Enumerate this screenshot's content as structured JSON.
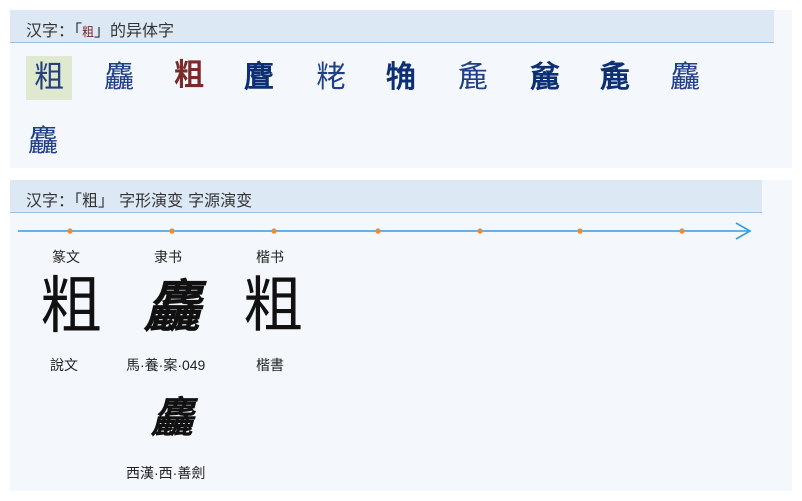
{
  "variants_panel": {
    "title_prefix": "汉字：「",
    "title_glyph": "粗",
    "title_suffix": "」的异体字",
    "items": [
      "粗",
      "麤",
      "粗",
      "麆",
      "粩",
      "觕",
      "麁",
      "麄",
      "麁",
      "麤",
      "麤"
    ]
  },
  "evolution_panel": {
    "title": "汉字：「粗」 字形演变 字源演变",
    "stages": [
      {
        "script": "篆文",
        "glyph": "粗",
        "source": "說文"
      },
      {
        "script": "隶书",
        "glyph": "麤",
        "source": "馬·養·案·049"
      },
      {
        "script": "楷书",
        "glyph": "粗",
        "source": "楷書"
      }
    ],
    "extra": {
      "glyph": "麤",
      "source": "西漢·西·善劍"
    }
  },
  "colors": {
    "header_bg": "#dde8f5",
    "panel_bg": "#f4f7fc",
    "timeline_line": "#3a9bd9",
    "timeline_dot": "#f08a2a"
  }
}
